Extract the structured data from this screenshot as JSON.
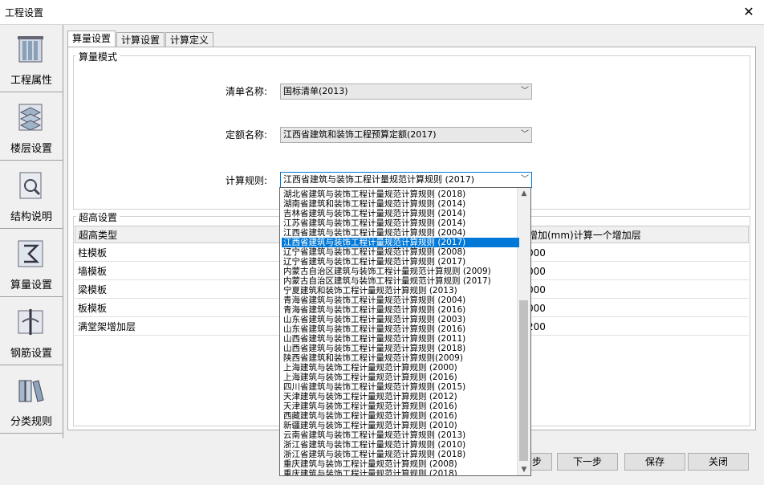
{
  "window": {
    "title": "工程设置",
    "close": "✕"
  },
  "leftnav": [
    {
      "label": "工程属性",
      "icon": "building-icon"
    },
    {
      "label": "楼层设置",
      "icon": "floors-icon"
    },
    {
      "label": "结构说明",
      "icon": "magnifier-doc-icon"
    },
    {
      "label": "算量设置",
      "icon": "sigma-icon"
    },
    {
      "label": "钢筋设置",
      "icon": "rebar-icon"
    },
    {
      "label": "分类规则",
      "icon": "books-icon"
    }
  ],
  "tabs": [
    "算量设置",
    "计算设置",
    "计算定义"
  ],
  "mode_group": {
    "title": "算量模式",
    "list_label": "清单名称:",
    "list_value": "国标清单(2013)",
    "quota_label": "定额名称:",
    "quota_value": "江西省建筑和装饰工程预算定额(2017)",
    "rule_label": "计算规则:",
    "rule_value": "江西省建筑与装饰工程计量规范计算规则 (2017)"
  },
  "height_group": {
    "title": "超高设置",
    "columns": [
      "超高类型",
      "增加(mm)计算一个增加层"
    ],
    "rows": [
      {
        "type": "柱模板",
        "value": "000"
      },
      {
        "type": "墙模板",
        "value": "000"
      },
      {
        "type": "梁模板",
        "value": "000"
      },
      {
        "type": "板模板",
        "value": "000"
      },
      {
        "type": "满堂架增加层",
        "value": "200"
      }
    ]
  },
  "dropdown": {
    "selected_index": 5,
    "items": [
      "湖北省建筑与装饰工程计量规范计算规则 (2018)",
      "湖南省建筑和装饰工程计量规范计算规则 (2014)",
      "吉林省建筑与装饰工程计量规范计算规则 (2014)",
      "江苏省建筑与装饰工程计量规范计算规则 (2014)",
      "江西省建筑与装饰工程计量规范计算规则 (2004)",
      "江西省建筑与装饰工程计量规范计算规则 (2017)",
      "辽宁省建筑与装饰工程计量规范计算规则 (2008)",
      "辽宁省建筑与装饰工程计量规范计算规则 (2017)",
      "内蒙古自治区建筑与装饰工程计量规范计算规则 (2009)",
      "内蒙古自治区建筑与装饰工程计量规范计算规则 (2017)",
      "宁夏建筑和装饰工程计量规范计算规则 (2013)",
      "青海省建筑与装饰工程计量规范计算规则 (2004)",
      "青海省建筑与装饰工程计量规范计算规则 (2016)",
      "山东省建筑与装饰工程计量规范计算规则 (2003)",
      "山东省建筑与装饰工程计量规范计算规则 (2016)",
      "山西省建筑与装饰工程计量规范计算规则 (2011)",
      "山西省建筑与装饰工程计量规范计算规则 (2018)",
      "陕西省建筑和装饰工程计量规范计算规则(2009)",
      "上海建筑与装饰工程计量规范计算规则 (2000)",
      "上海建筑与装饰工程计量规范计算规则 (2016)",
      "四川省建筑与装饰工程计量规范计算规则 (2015)",
      "天津建筑与装饰工程计量规范计算规则 (2012)",
      "天津建筑与装饰工程计量规范计算规则 (2016)",
      "西藏建筑与装饰工程计量规范计算规则 (2016)",
      "新疆建筑与装饰工程计量规范计算规则 (2010)",
      "云南省建筑与装饰工程计量规范计算规则 (2013)",
      "浙江省建筑与装饰工程计量规范计算规则 (2010)",
      "浙江省建筑与装饰工程计量规范计算规则 (2018)",
      "重庆建筑与装饰工程计量规范计算规则 (2008)",
      "重庆建筑与装饰工程计量规范计算规则 (2018)"
    ]
  },
  "buttons": {
    "prev": "步",
    "next": "下一步",
    "save": "保存",
    "close": "关闭"
  }
}
